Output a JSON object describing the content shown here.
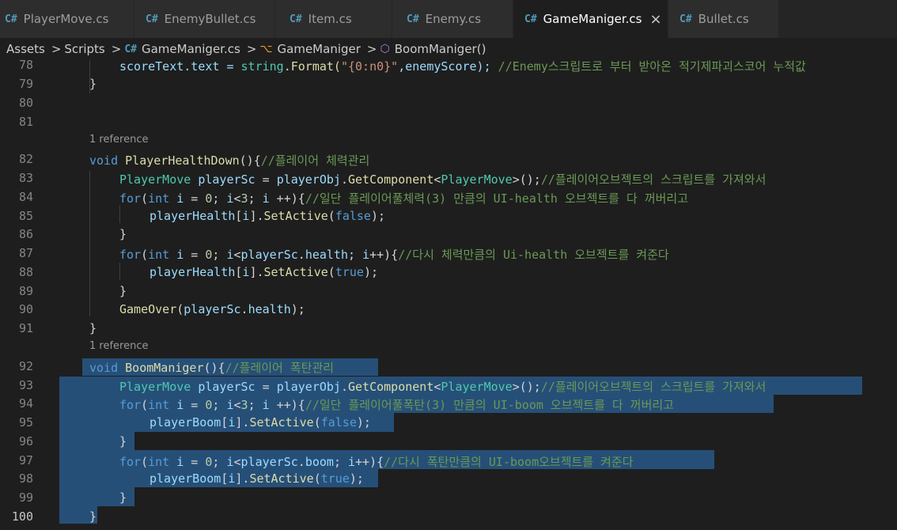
{
  "tabs": [
    {
      "label": "PlayerMove.cs",
      "icon": "csharp-file-icon"
    },
    {
      "label": "EnemyBullet.cs",
      "icon": "csharp-file-icon"
    },
    {
      "label": "Item.cs",
      "icon": "csharp-file-icon"
    },
    {
      "label": "Enemy.cs",
      "icon": "csharp-file-icon"
    },
    {
      "label": "GameManiger.cs",
      "icon": "csharp-file-icon",
      "active": true
    },
    {
      "label": "Bullet.cs",
      "icon": "csharp-file-icon"
    }
  ],
  "breadcrumb": {
    "assets": "Assets",
    "scripts": "Scripts",
    "file": "GameManiger.cs",
    "class": "GameManiger",
    "method": "BoomManiger()"
  },
  "glyphs": {
    "cs": "C#",
    "close": "×",
    "sep": ">",
    "class": "⌥",
    "method": "⬡"
  },
  "editor": {
    "references": [
      "1 reference",
      "1 reference"
    ],
    "line_numbers": [
      "78",
      "79",
      "80",
      "81",
      "82",
      "83",
      "84",
      "85",
      "86",
      "87",
      "88",
      "89",
      "90",
      "91",
      "92",
      "93",
      "94",
      "95",
      "96",
      "97",
      "98",
      "99",
      "100"
    ],
    "code": {
      "l78": {
        "a": "scoreText.text = ",
        "b": "string",
        "c": ".Format(",
        "d": "\"{0:n0}\"",
        "e": ",enemyScore); ",
        "f": "//Enemy스크립트로 부터 받아온 적기제파괴스코어 누적값"
      },
      "l79": "}",
      "l82": {
        "a": "void",
        "b": "PlayerHealthDown",
        "c": "(){",
        "d": "//플레이어 체력관리"
      },
      "l83": {
        "a": "PlayerMove",
        "b": "playerSc",
        "c": " = ",
        "d": "playerObj",
        "e": ".",
        "f": "GetComponent",
        "g": "<",
        "h": "PlayerMove",
        "i": ">();",
        "j": "//플레이어오브젝트의 스크립트를 가져와서"
      },
      "l84": {
        "a": "for",
        "b": "(",
        "c": "int",
        "d": "i",
        "e": " = ",
        "f": "0",
        "g": "; ",
        "h": "i",
        "i": "<",
        "j": "3",
        "k": "; ",
        "l": "i",
        "m": " ++){",
        "n": "//일단 플레이어풀체력(3) 만큼의 UI-health 오브젝트를 다 꺼버리고"
      },
      "l85": {
        "a": "playerHealth",
        "b": "[",
        "c": "i",
        "d": "].",
        "e": "SetActive",
        "f": "(",
        "g": "false",
        "h": ");"
      },
      "l86": "}",
      "l87": {
        "a": "for",
        "b": "(",
        "c": "int",
        "d": "i",
        "e": " = ",
        "f": "0",
        "g": "; ",
        "h": "i",
        "i": "<",
        "j": "playerSc",
        "k": ".",
        "l": "health",
        "m": "; ",
        "n": "i",
        "o": "++){",
        "p": "//다시 체력만큼의 Ui-health 오브젝트를 켜준다"
      },
      "l88": {
        "a": "playerHealth",
        "b": "[",
        "c": "i",
        "d": "].",
        "e": "SetActive",
        "f": "(",
        "g": "true",
        "h": ");"
      },
      "l89": "}",
      "l90": {
        "a": "GameOver",
        "b": "(",
        "c": "playerSc",
        "d": ".",
        "e": "health",
        "f": ");"
      },
      "l91": "}",
      "l92": {
        "a": "void",
        "b": "BoomManiger",
        "c": "(){",
        "d": "//플레이어 폭탄관리"
      },
      "l93": {
        "a": "PlayerMove",
        "b": "playerSc",
        "c": " = ",
        "d": "playerObj",
        "e": ".",
        "f": "GetComponent",
        "g": "<",
        "h": "PlayerMove",
        "i": ">();",
        "j": "//플레이어오브젝트의 스크립트를 가져와서"
      },
      "l94": {
        "a": "for",
        "b": "(",
        "c": "int",
        "d": "i",
        "e": " = ",
        "f": "0",
        "g": "; ",
        "h": "i",
        "i": "<",
        "j": "3",
        "k": "; ",
        "l": "i",
        "m": " ++){",
        "n": "//일단 플레이어풀폭탄(3) 만큼의 UI-boom 오브젝트를 다 꺼버리고"
      },
      "l95": {
        "a": "playerBoom",
        "b": "[",
        "c": "i",
        "d": "].",
        "e": "SetActive",
        "f": "(",
        "g": "false",
        "h": ");"
      },
      "l96": "}",
      "l97": {
        "a": "for",
        "b": "(",
        "c": "int",
        "d": "i",
        "e": " = ",
        "f": "0",
        "g": "; ",
        "h": "i",
        "i": "<",
        "j": "playerSc",
        "k": ".",
        "l": "boom",
        "m": "; ",
        "n": "i",
        "o": "++){",
        "p": "//다시 폭탄만큼의 UI-boom오브젝트를 켜준다"
      },
      "l98": {
        "a": "playerBoom",
        "b": "[",
        "c": "i",
        "d": "].",
        "e": "SetActive",
        "f": "(",
        "g": "true",
        "h": ");"
      },
      "l99": "}",
      "l100": "}"
    }
  },
  "colors": {
    "background": "#1e1e1e",
    "tab_inactive": "#2d2d2d",
    "selection": "#264f78",
    "keyword": "#569cd6",
    "type": "#4ec9b0",
    "function": "#dcdcaa",
    "variable": "#9cdcfe",
    "number": "#b5cea8",
    "string": "#ce9178",
    "comment": "#6a9955"
  }
}
